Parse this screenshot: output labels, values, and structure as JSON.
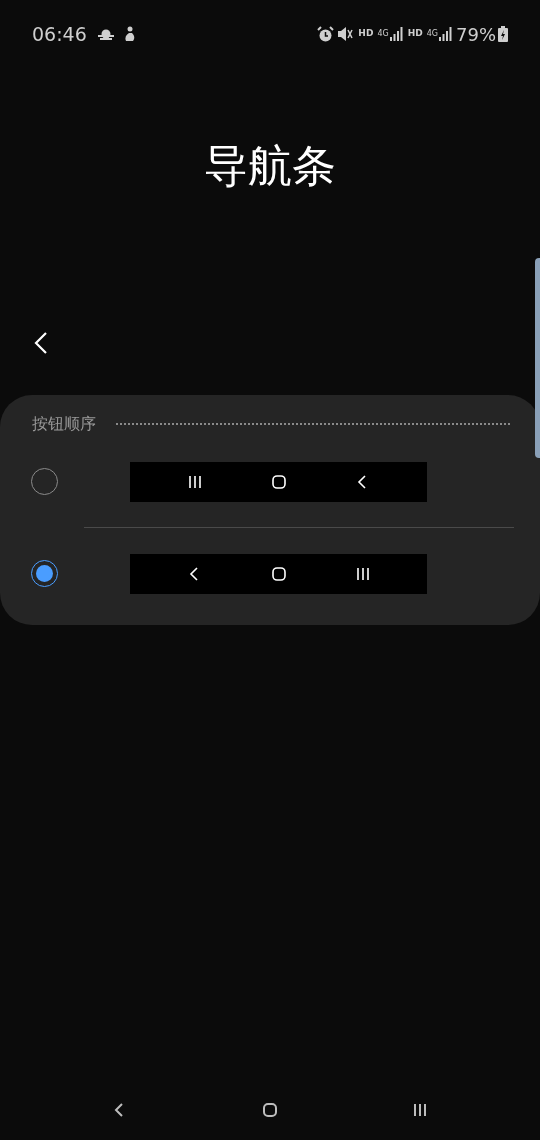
{
  "status_bar": {
    "time": "06:46",
    "network": [
      {
        "label": "HD",
        "generation": "4G"
      },
      {
        "label": "HD",
        "generation": "4G"
      }
    ],
    "battery": "79%"
  },
  "title": "导航条",
  "section": {
    "header": "按钮顺序",
    "options": [
      {
        "selected": false,
        "buttons": [
          {
            "kind": "recents"
          },
          {
            "kind": "home"
          },
          {
            "kind": "back"
          }
        ]
      },
      {
        "selected": true,
        "buttons": [
          {
            "kind": "back"
          },
          {
            "kind": "home"
          },
          {
            "kind": "recents"
          }
        ]
      }
    ]
  },
  "nav_bar": {
    "buttons": [
      {
        "kind": "back"
      },
      {
        "kind": "home"
      },
      {
        "kind": "recents"
      }
    ]
  }
}
